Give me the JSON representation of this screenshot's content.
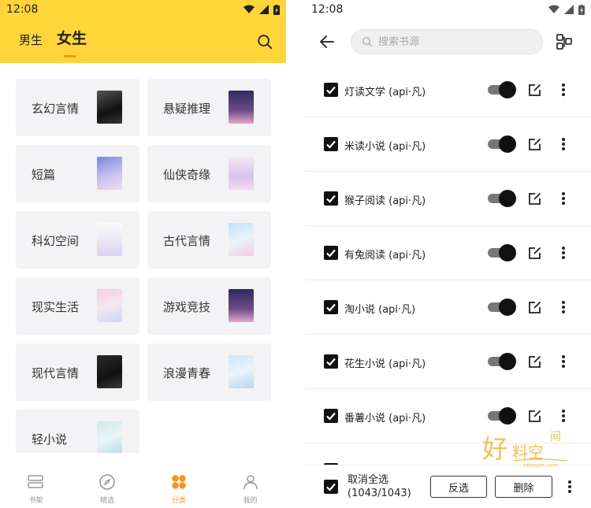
{
  "left": {
    "status": {
      "time": "12:08"
    },
    "tabs": [
      {
        "label": "男生"
      },
      {
        "label": "女生"
      }
    ],
    "categories": [
      {
        "label": "玄幻言情",
        "cover": "#2a2a2a"
      },
      {
        "label": "悬疑推理",
        "cover": "#3a3f6b"
      },
      {
        "label": "短篇",
        "cover": "#b9b6e8"
      },
      {
        "label": "仙侠奇缘",
        "cover": "#e8d4f0"
      },
      {
        "label": "科幻空间",
        "cover": "#f1eef7"
      },
      {
        "label": "古代言情",
        "cover": "#c7e3f2"
      },
      {
        "label": "现实生活",
        "cover": "#f0c8dc"
      },
      {
        "label": "游戏竞技",
        "cover": "#3a3f6b"
      },
      {
        "label": "现代言情",
        "cover": "#1a1a1a"
      },
      {
        "label": "浪漫青春",
        "cover": "#d2e6f4"
      },
      {
        "label": "轻小说",
        "cover": "#cde8e6"
      }
    ],
    "nav": [
      {
        "label": "书架",
        "icon": "bookshelf-icon"
      },
      {
        "label": "精选",
        "icon": "compass-icon"
      },
      {
        "label": "分类",
        "icon": "category-icon"
      },
      {
        "label": "我的",
        "icon": "person-icon"
      }
    ],
    "accent": "#F7931E",
    "header_color": "#FFD53A"
  },
  "right": {
    "status": {
      "time": "12:08"
    },
    "search": {
      "placeholder": "搜索书源"
    },
    "sources": [
      {
        "name": "灯读文学 (api·凡)",
        "checked": true,
        "enabled": true
      },
      {
        "name": "米读小说 (api·凡)",
        "checked": true,
        "enabled": true
      },
      {
        "name": "猴子阅读 (api·凡)",
        "checked": true,
        "enabled": true
      },
      {
        "name": "有兔阅读 (api·凡)",
        "checked": true,
        "enabled": true
      },
      {
        "name": "淘小说 (api·凡)",
        "checked": true,
        "enabled": true
      },
      {
        "name": "花生小说 (api·凡)",
        "checked": true,
        "enabled": true
      },
      {
        "name": "番薯小说 (api·凡)",
        "checked": true,
        "enabled": true
      }
    ],
    "footer": {
      "select_label": "取消全选",
      "select_count": "(1043/1043)",
      "invert_label": "反选",
      "delete_label": "删除"
    }
  },
  "watermark": {
    "text": "好料空间",
    "url": "h6room.com"
  }
}
